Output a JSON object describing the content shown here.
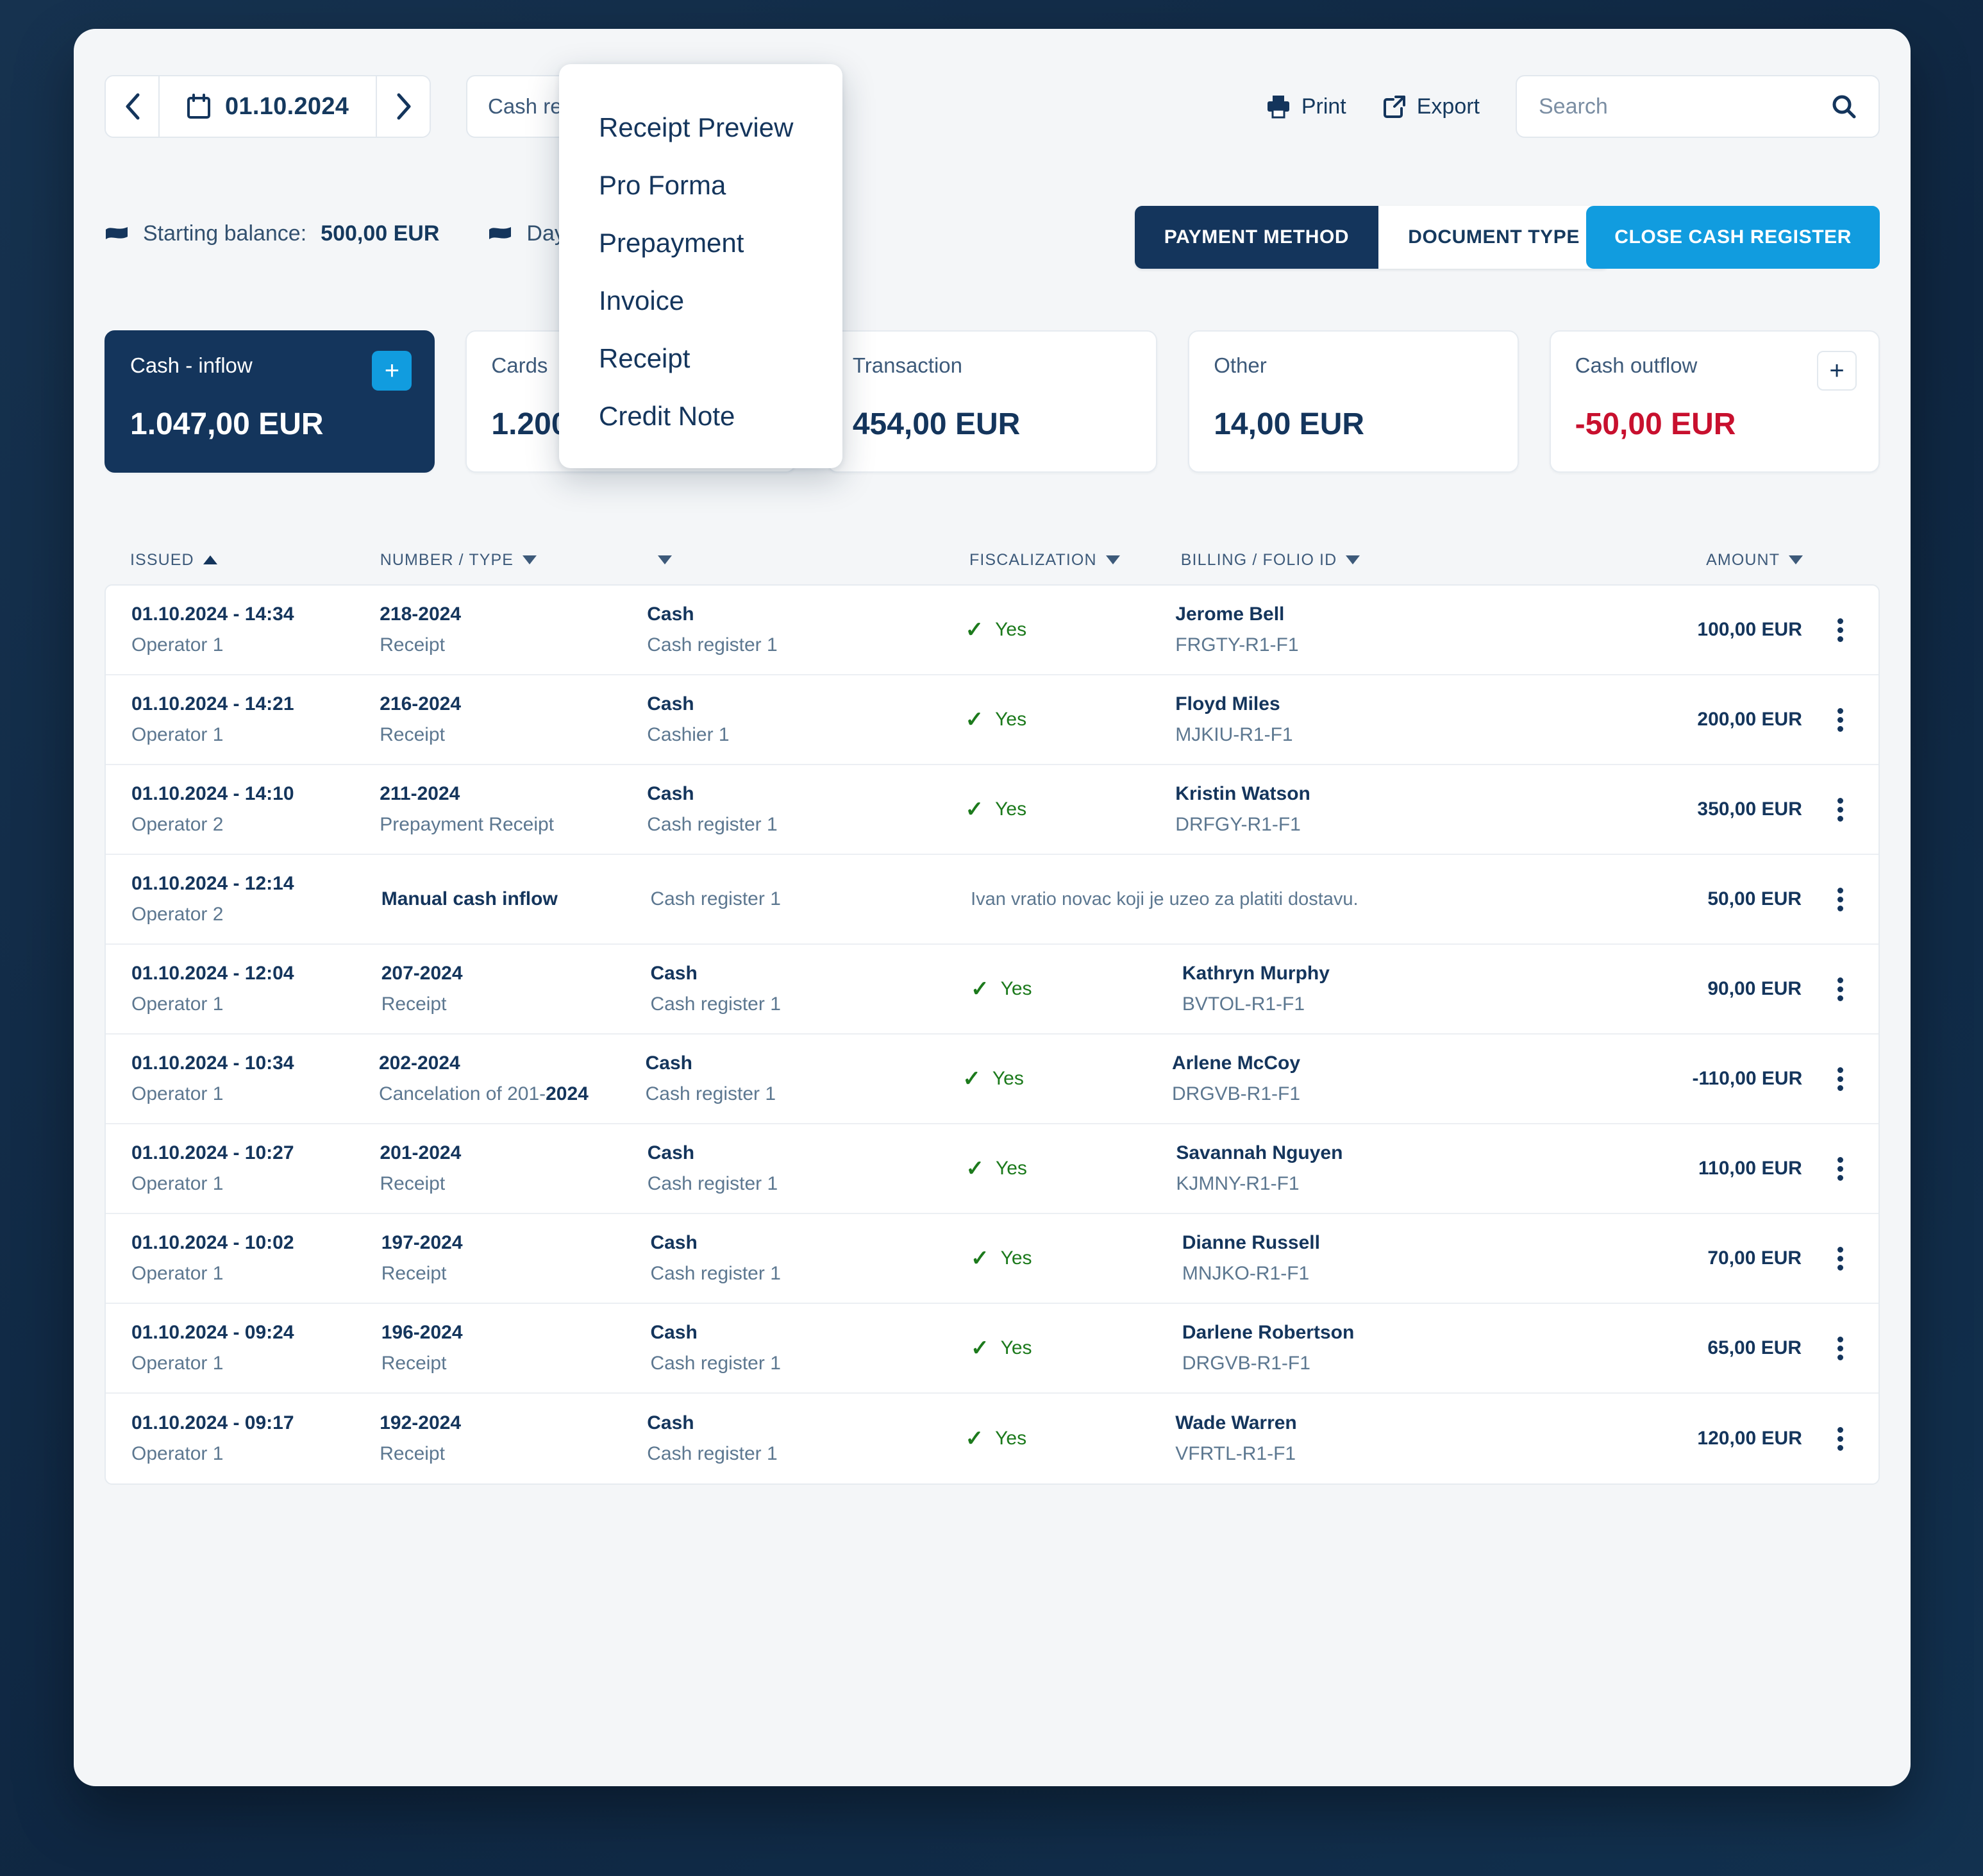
{
  "toolbar": {
    "prev_label": "‹",
    "next_label": "›",
    "date_value": "01.10.2024",
    "register_select_value": "Cash registers / cashiers",
    "print_label": "Print",
    "export_label": "Export",
    "search_placeholder": "Search",
    "search_value": ""
  },
  "balances": {
    "starting_label": "Starting balance:",
    "starting_value": "500,00 EUR",
    "day_label": "Day balance:",
    "day_value": ""
  },
  "segmented": {
    "payment_method": "PAYMENT METHOD",
    "document_type": "DOCUMENT TYPE",
    "active": "PAYMENT METHOD"
  },
  "close_register_label": "CLOSE CASH REGISTER",
  "cards": [
    {
      "label": "Cash - inflow",
      "value": "1.047,00 EUR",
      "variant": "dark",
      "plus": "+"
    },
    {
      "label": "Cards",
      "value": "1.200,00 EUR",
      "variant": "light",
      "plus": ""
    },
    {
      "label": "Transaction",
      "value": "454,00 EUR",
      "variant": "light",
      "plus": ""
    },
    {
      "label": "Other",
      "value": "14,00 EUR",
      "variant": "light",
      "plus": ""
    },
    {
      "label": "Cash outflow",
      "value": "-50,00 EUR",
      "variant": "light-neg",
      "plus": "+"
    }
  ],
  "dropdown": {
    "items": [
      "Receipt Preview",
      "Pro Forma",
      "Prepayment",
      "Invoice",
      "Receipt",
      "Credit Note"
    ]
  },
  "table": {
    "headers": {
      "issued": "ISSUED",
      "number_type": "NUMBER / TYPE",
      "payment": "",
      "fiscalization": "FISCALIZATION",
      "billing": "BILLING / FOLIO ID",
      "amount": "AMOUNT"
    },
    "sort": {
      "column": "ISSUED",
      "direction": "asc"
    },
    "rows": [
      {
        "issued": "01.10.2024 - 14:34",
        "operator": "Operator 1",
        "number": "218-2024",
        "type": "Receipt",
        "method": "Cash",
        "source": "Cash register 1",
        "fiscalization": "Yes",
        "fiscalized": true,
        "billing_name": "Jerome Bell",
        "folio_id": "FRGTY-R1-F1",
        "amount": "100,00 EUR",
        "negative": false,
        "note": ""
      },
      {
        "issued": "01.10.2024 - 14:21",
        "operator": "Operator 1",
        "number": "216-2024",
        "type": "Receipt",
        "method": "Cash",
        "source": "Cashier 1",
        "fiscalization": "Yes",
        "fiscalized": true,
        "billing_name": "Floyd Miles",
        "folio_id": "MJKIU-R1-F1",
        "amount": "200,00 EUR",
        "negative": false,
        "note": ""
      },
      {
        "issued": "01.10.2024 - 14:10",
        "operator": "Operator 2",
        "number": "211-2024",
        "type": "Prepayment Receipt",
        "method": "Cash",
        "source": "Cash register 1",
        "fiscalization": "Yes",
        "fiscalized": true,
        "billing_name": "Kristin Watson",
        "folio_id": "DRFGY-R1-F1",
        "amount": "350,00 EUR",
        "negative": false,
        "note": ""
      },
      {
        "issued": "01.10.2024 - 12:14",
        "operator": "Operator 2",
        "number": "Manual cash inflow",
        "type": "",
        "method": "",
        "source": "Cash register 1",
        "fiscalization": "",
        "fiscalized": false,
        "billing_name": "",
        "folio_id": "",
        "amount": "50,00 EUR",
        "negative": false,
        "note": "Ivan vratio novac koji je uzeo za platiti dostavu."
      },
      {
        "issued": "01.10.2024 - 12:04",
        "operator": "Operator 1",
        "number": "207-2024",
        "type": "Receipt",
        "method": "Cash",
        "source": "Cash register 1",
        "fiscalization": "Yes",
        "fiscalized": true,
        "billing_name": "Kathryn Murphy",
        "folio_id": "BVTOL-R1-F1",
        "amount": "90,00 EUR",
        "negative": false,
        "note": ""
      },
      {
        "issued": "01.10.2024 - 10:34",
        "operator": "Operator 1",
        "number": "202-2024",
        "type": "Cancelation of 201-2024",
        "type_prefix": "Cancelation of 201-",
        "type_bold": "2024",
        "method": "Cash",
        "source": "Cash register 1",
        "fiscalization": "Yes",
        "fiscalized": true,
        "billing_name": "Arlene McCoy",
        "folio_id": "DRGVB-R1-F1",
        "amount": "-110,00 EUR",
        "negative": true,
        "note": ""
      },
      {
        "issued": "01.10.2024 - 10:27",
        "operator": "Operator 1",
        "number": "201-2024",
        "type": "Receipt",
        "method": "Cash",
        "source": "Cash register 1",
        "fiscalization": "Yes",
        "fiscalized": true,
        "billing_name": "Savannah Nguyen",
        "folio_id": "KJMNY-R1-F1",
        "amount": "110,00 EUR",
        "negative": false,
        "note": ""
      },
      {
        "issued": "01.10.2024 - 10:02",
        "operator": "Operator 1",
        "number": "197-2024",
        "type": "Receipt",
        "method": "Cash",
        "source": "Cash register 1",
        "fiscalization": "Yes",
        "fiscalized": true,
        "billing_name": "Dianne Russell",
        "folio_id": "MNJKO-R1-F1",
        "amount": "70,00 EUR",
        "negative": false,
        "note": ""
      },
      {
        "issued": "01.10.2024 - 09:24",
        "operator": "Operator 1",
        "number": "196-2024",
        "type": "Receipt",
        "method": "Cash",
        "source": "Cash register 1",
        "fiscalization": "Yes",
        "fiscalized": true,
        "billing_name": "Darlene Robertson",
        "folio_id": "DRGVB-R1-F1",
        "amount": "65,00 EUR",
        "negative": false,
        "note": ""
      },
      {
        "issued": "01.10.2024 - 09:17",
        "operator": "Operator 1",
        "number": "192-2024",
        "type": "Receipt",
        "method": "Cash",
        "source": "Cash register 1",
        "fiscalization": "Yes",
        "fiscalized": true,
        "billing_name": "Wade Warren",
        "folio_id": "VFRTL-R1-F1",
        "amount": "120,00 EUR",
        "negative": false,
        "note": ""
      }
    ]
  },
  "colors": {
    "brand_dark": "#14355c",
    "accent_blue": "#119cdf",
    "negative_red": "#c8102e",
    "success_green": "#1c7a1c",
    "desk_navy": "#102a43",
    "panel_bg": "#f4f6f8"
  }
}
